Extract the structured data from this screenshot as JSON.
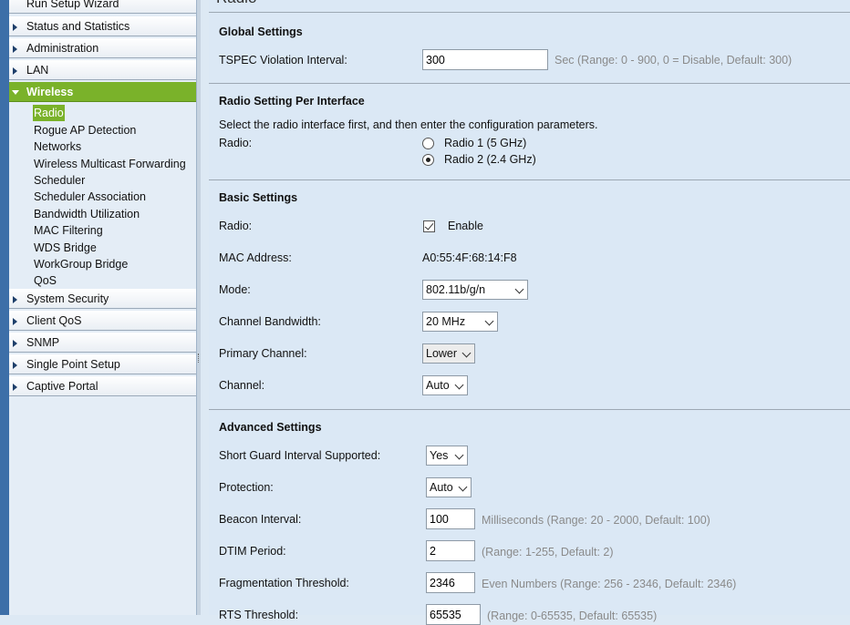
{
  "sidebar": {
    "top_items": [
      {
        "label": "Run Setup Wizard"
      },
      {
        "label": "Status and Statistics"
      },
      {
        "label": "Administration"
      },
      {
        "label": "LAN"
      },
      {
        "label": "Wireless"
      }
    ],
    "wireless_sub": [
      {
        "label": "Radio"
      },
      {
        "label": "Rogue AP Detection"
      },
      {
        "label": "Networks"
      },
      {
        "label": "Wireless Multicast Forwarding"
      },
      {
        "label": "Scheduler"
      },
      {
        "label": "Scheduler Association"
      },
      {
        "label": "Bandwidth Utilization"
      },
      {
        "label": "MAC Filtering"
      },
      {
        "label": "WDS Bridge"
      },
      {
        "label": "WorkGroup Bridge"
      },
      {
        "label": "QoS"
      }
    ],
    "bottom_items": [
      {
        "label": "System Security"
      },
      {
        "label": "Client QoS"
      },
      {
        "label": "SNMP"
      },
      {
        "label": "Single Point Setup"
      },
      {
        "label": "Captive Portal"
      }
    ]
  },
  "main": {
    "page_title": "Radio",
    "global": {
      "title": "Global Settings",
      "tspec_label": "TSPEC Violation Interval:",
      "tspec_value": "300",
      "tspec_hint": "Sec (Range: 0 - 900, 0 = Disable, Default: 300)"
    },
    "per_interface": {
      "title": "Radio Setting Per Interface",
      "description": "Select the radio interface first, and then enter the configuration parameters.",
      "radio_label": "Radio:",
      "option1": "Radio 1 (5 GHz)",
      "option2": "Radio 2 (2.4 GHz)",
      "selected": "Radio 2 (2.4 GHz)"
    },
    "basic": {
      "title": "Basic Settings",
      "radio_label": "Radio:",
      "enable_label": "Enable",
      "enable_checked": true,
      "mac_label": "MAC Address:",
      "mac_value": "A0:55:4F:68:14:F8",
      "mode_label": "Mode:",
      "mode_value": "802.11b/g/n",
      "bandwidth_label": "Channel Bandwidth:",
      "bandwidth_value": "20 MHz",
      "primary_label": "Primary Channel:",
      "primary_value": "Lower",
      "channel_label": "Channel:",
      "channel_value": "Auto"
    },
    "advanced": {
      "title": "Advanced Settings",
      "sgi_label": "Short Guard Interval Supported:",
      "sgi_value": "Yes",
      "protection_label": "Protection:",
      "protection_value": "Auto",
      "beacon_label": "Beacon Interval:",
      "beacon_value": "100",
      "beacon_hint": "Milliseconds (Range: 20 - 2000, Default: 100)",
      "dtim_label": "DTIM Period:",
      "dtim_value": "2",
      "dtim_hint": "(Range: 1-255, Default: 2)",
      "frag_label": "Fragmentation Threshold:",
      "frag_value": "2346",
      "frag_hint": "Even Numbers (Range: 256 - 2346, Default: 2346)",
      "rts_label": "RTS Threshold:",
      "rts_value": "65535",
      "rts_hint": "(Range: 0-65535, Default: 65535)"
    }
  }
}
